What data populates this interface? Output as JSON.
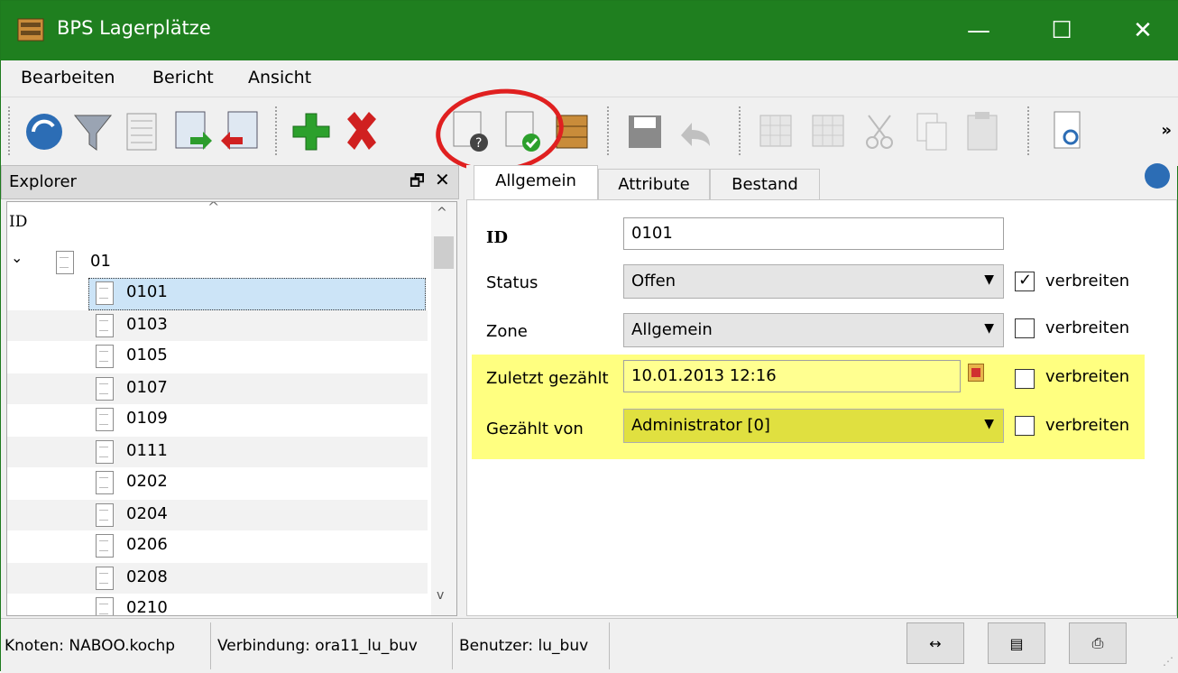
{
  "window": {
    "title": "BPS Lagerplätze",
    "icons": {
      "app": "bookshelf-icon",
      "minimize": "minimize-icon",
      "maximize": "maximize-icon",
      "close": "close-icon"
    },
    "controls": {
      "minimize": "—",
      "maximize": "☐",
      "close": "✕"
    }
  },
  "menu": {
    "items": [
      "Bearbeiten",
      "Bericht",
      "Ansicht"
    ]
  },
  "toolbar": {
    "buttons": [
      "refresh-icon",
      "filter-icon",
      "list-icon",
      "import-icon",
      "export-icon",
      "add-icon",
      "delete-icon",
      "inventory-query-icon",
      "inventory-check-icon",
      "shelf-icon",
      "save-icon",
      "undo-icon",
      "grid-add-icon",
      "grid-delete-icon",
      "cut-icon",
      "copy-icon",
      "paste-icon",
      "preview-icon"
    ],
    "overflow": "»"
  },
  "explorer": {
    "title": "Explorer",
    "restore_glyph": "🗗",
    "close_glyph": "✕",
    "column_header": "ID",
    "sort_glyph": "^",
    "root": {
      "expander": "⌄",
      "label": "01"
    },
    "items": [
      "0101",
      "0103",
      "0105",
      "0107",
      "0109",
      "0111",
      "0202",
      "0204",
      "0206",
      "0208",
      "0210"
    ],
    "selected": "0101",
    "scroll": {
      "up": "^",
      "down": "v"
    }
  },
  "tabs": {
    "items": [
      "Allgemein",
      "Attribute",
      "Bestand"
    ],
    "active": "Allgemein"
  },
  "form": {
    "id": {
      "label": "ID",
      "value": "0101"
    },
    "status": {
      "label": "Status",
      "value": "Offen",
      "propagate": true
    },
    "zone": {
      "label": "Zone",
      "value": "Allgemein",
      "propagate": false
    },
    "counted": {
      "label": "Zuletzt gezählt",
      "value": "10.01.2013 12:16",
      "propagate": false
    },
    "counted_by": {
      "label": "Gezählt von",
      "value": "Administrator [0]",
      "propagate": false
    },
    "propagate_label": "verbreiten",
    "check_mark": "✓",
    "dropdown_glyph": "▼",
    "highlight_color": "#ffff80"
  },
  "statusbar": {
    "node": "Knoten: NABOO.kochp",
    "connection": "Verbindung: ora11_lu_buv",
    "user": "Benutzer: lu_buv",
    "buttons": [
      "fit-width-icon",
      "import-list-icon",
      "printer-icon"
    ],
    "button_glyphs": [
      "↔",
      "▤",
      "⎙"
    ],
    "grip": "⋰"
  },
  "colors": {
    "titlebar": "#1f7f1f",
    "annotation": "#e02020",
    "selection": "#cce4f7"
  }
}
